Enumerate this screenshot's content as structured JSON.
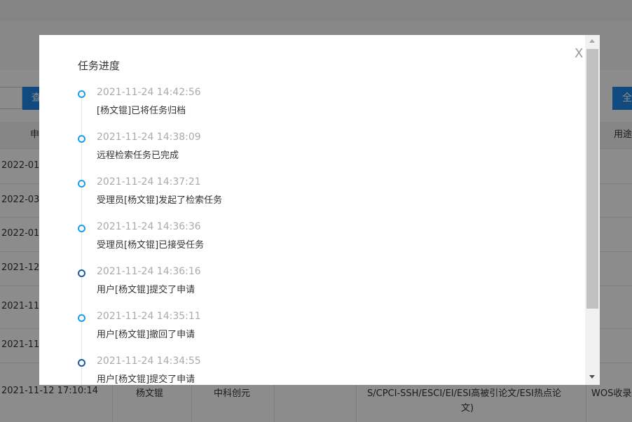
{
  "background": {
    "query_button": "查",
    "all_button": "全",
    "headers": {
      "apply": "申",
      "purpose": "用途"
    },
    "rows": [
      {
        "date": "2022-01"
      },
      {
        "date": "2022-03"
      },
      {
        "date": "2022-01"
      },
      {
        "date": "2021-12"
      },
      {
        "date": "2021-11"
      },
      {
        "date": "2021-11"
      }
    ],
    "last_row": {
      "datetime": "2021-11-12 17:10:14",
      "name": "杨文锟",
      "org": "中科创元",
      "scope_line1": "S/CPCI-SSH/ESCI/EI/ESI高被引论文/ESI热点论",
      "scope_line2": "文)",
      "purpose": "WOS收录"
    }
  },
  "modal": {
    "title": "任务进度",
    "close_label": "X",
    "timeline": [
      {
        "time": "2021-11-24 14:42:56",
        "text": "[杨文锟]已将任务归档",
        "dot": "light"
      },
      {
        "time": "2021-11-24 14:38:09",
        "text": "远程检索任务已完成",
        "dot": "light"
      },
      {
        "time": "2021-11-24 14:37:21",
        "text": "受理员[杨文锟]发起了检索任务",
        "dot": "light"
      },
      {
        "time": "2021-11-24 14:36:36",
        "text": "受理员[杨文锟]已接受任务",
        "dot": "light"
      },
      {
        "time": "2021-11-24 14:36:16",
        "text": "用户[杨文锟]提交了申请",
        "dot": "dark"
      },
      {
        "time": "2021-11-24 14:35:11",
        "text": "用户[杨文锟]撤回了申请",
        "dot": "light"
      },
      {
        "time": "2021-11-24 14:34:55",
        "text": "用户[杨文锟]提交了申请",
        "dot": "dark"
      }
    ]
  },
  "colors": {
    "accent": "#1e9bf0",
    "accent_dark": "#1a5aa8",
    "button_blue": "#1e88e5"
  }
}
